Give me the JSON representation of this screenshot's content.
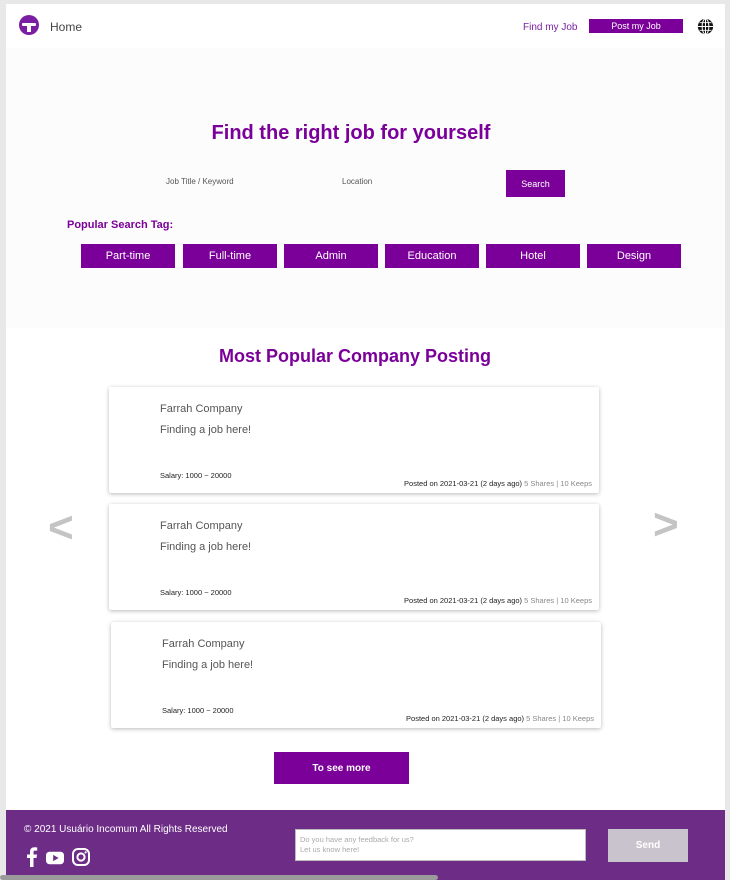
{
  "frame": {
    "label": "Landing page"
  },
  "header": {
    "home_label": "Home",
    "find_job_label": "Find my Job",
    "post_job_label": "Post my Job",
    "logo_icon": "umbrella-logo-icon",
    "globe_icon": "globe-icon"
  },
  "hero": {
    "title": "Find the right job for yourself",
    "job_placeholder": "Job Title / Keyword",
    "location_placeholder": "Location",
    "search_label": "Search",
    "tags_label": "Popular Search Tag:",
    "tags": [
      "Part-time",
      "Full-time",
      "Admin",
      "Education",
      "Hotel",
      "Design"
    ]
  },
  "postings": {
    "title": "Most Popular Company Posting",
    "items": [
      {
        "company": "Farrah Company",
        "tagline": "Finding a job here!",
        "salary": "Salary: 1000 ~ 20000",
        "posted": "Posted on 2021-03-21 (2 days ago)",
        "shares": "5 Shares",
        "separator": "|",
        "keeps": "10 Keeps"
      },
      {
        "company": "Farrah Company",
        "tagline": "Finding a job here!",
        "salary": "Salary: 1000 ~ 20000",
        "posted": "Posted on 2021-03-21 (2 days ago)",
        "shares": "5 Shares",
        "separator": "|",
        "keeps": "10 Keeps"
      },
      {
        "company": "Farrah Company",
        "tagline": "Finding a job here!",
        "salary": "Salary: 1000 ~ 20000",
        "posted": "Posted on 2021-03-21 (2 days ago)",
        "shares": "5 Shares",
        "separator": "|",
        "keeps": "10 Keeps"
      }
    ],
    "prev_arrow": "<",
    "next_arrow": ">",
    "more_label": "To see more"
  },
  "footer": {
    "copyright": "© 2021 Usuário Incomum All Rights Reserved",
    "feedback_line1": "Do you have any feedback for us?",
    "feedback_line2": "Let us know here!",
    "send_label": "Send",
    "social_icons": [
      "facebook-icon",
      "youtube-icon",
      "instagram-icon"
    ]
  },
  "colors": {
    "brand": "#7b0099",
    "footer": "#6d2c86",
    "send_disabled": "#c9c3cd"
  }
}
